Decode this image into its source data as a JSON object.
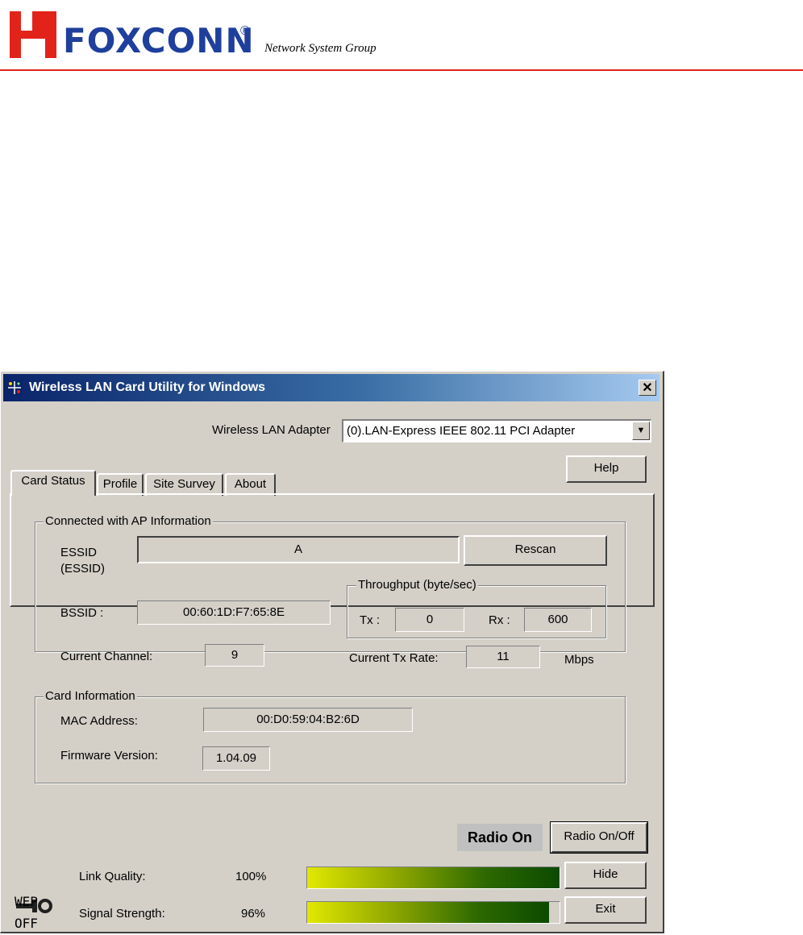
{
  "header": {
    "brand": "FOXCONN",
    "registered": "®",
    "group": "Network System Group"
  },
  "window": {
    "title": "Wireless LAN Card Utility for Windows",
    "close": "✕"
  },
  "adapter": {
    "label": "Wireless LAN Adapter",
    "value": "(0).LAN-Express IEEE 802.11 PCI Adapter"
  },
  "buttons": {
    "help": "Help",
    "rescan": "Rescan",
    "radio_toggle": "Radio On/Off",
    "hide": "Hide",
    "exit": "Exit"
  },
  "tabs": [
    "Card Status",
    "Profile",
    "Site Survey",
    "About"
  ],
  "ap_info": {
    "title": "Connected with AP Information",
    "essid_label": "ESSID",
    "essid_sub": "(ESSID)",
    "essid_value": "A",
    "bssid_label": "BSSID :",
    "bssid_value": "00:60:1D:F7:65:8E",
    "channel_label": "Current Channel:",
    "channel_value": "9",
    "throughput_title": "Throughput (byte/sec)",
    "tx_label": "Tx :",
    "tx_value": "0",
    "rx_label": "Rx :",
    "rx_value": "600",
    "rate_label": "Current Tx Rate:",
    "rate_value": "11",
    "rate_unit": "Mbps"
  },
  "card_info": {
    "title": "Card Information",
    "mac_label": "MAC Address:",
    "mac_value": "00:D0:59:04:B2:6D",
    "firmware_label": "Firmware Version:",
    "firmware_value": "1.04.09"
  },
  "status": {
    "radio_state": "Radio On",
    "wep_top": "WEP",
    "wep_bottom": "OFF",
    "link_label": "Link Quality:",
    "link_value": "100%",
    "link_fraction": 1.0,
    "signal_label": "Signal Strength:",
    "signal_value": "96%",
    "signal_fraction": 0.96
  },
  "colors": {
    "brand_red": "#e2231a",
    "brand_blue": "#1f3f9c",
    "dialog_face": "#d4d0c8",
    "titlebar_start": "#0a246a"
  }
}
